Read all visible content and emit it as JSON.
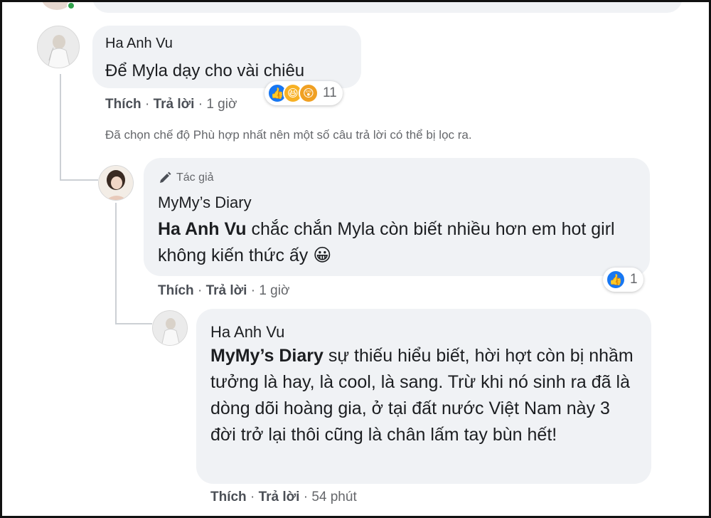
{
  "comments": [
    {
      "author": "Ha Anh Vu",
      "text": "Để Myla dạy cho vài chiêu",
      "actions": {
        "like": "Thích",
        "reply": "Trả lời",
        "time": "1 giờ"
      },
      "reactions": {
        "icons": [
          "like-icon",
          "haha-icon",
          "wow-icon"
        ],
        "count": "11"
      }
    },
    {
      "badge": "Tác giả",
      "author": "MyMy’s Diary",
      "mention": "Ha Anh Vu",
      "text": " chắc chắn Myla còn biết nhiều hơn em hot girl không kiến thức ấy 😀",
      "actions": {
        "like": "Thích",
        "reply": "Trả lời",
        "time": "1 giờ"
      },
      "reactions": {
        "icons": [
          "like-icon"
        ],
        "count": "1"
      }
    },
    {
      "author": "Ha Anh Vu",
      "mention": "MyMy’s Diary",
      "text": " sự thiếu hiểu biết, hời hợt còn bị nhầm tưởng là hay, là cool, là sang. Trừ khi nó sinh ra đã là dòng dõi hoàng gia, ở tại đất nước Việt Nam này 3 đời trở lại thôi cũng là chân lấm tay bùn hết!",
      "actions": {
        "like": "Thích",
        "reply": "Trả lời",
        "time": "54 phút"
      }
    }
  ],
  "filter_note": "Đã chọn chế độ Phù hợp nhất nên một số câu trả lời có thể bị lọc ra.",
  "separator": "·",
  "colors": {
    "bubble": "#f0f2f5",
    "like": "#1877f2",
    "meta": "#65676b"
  }
}
